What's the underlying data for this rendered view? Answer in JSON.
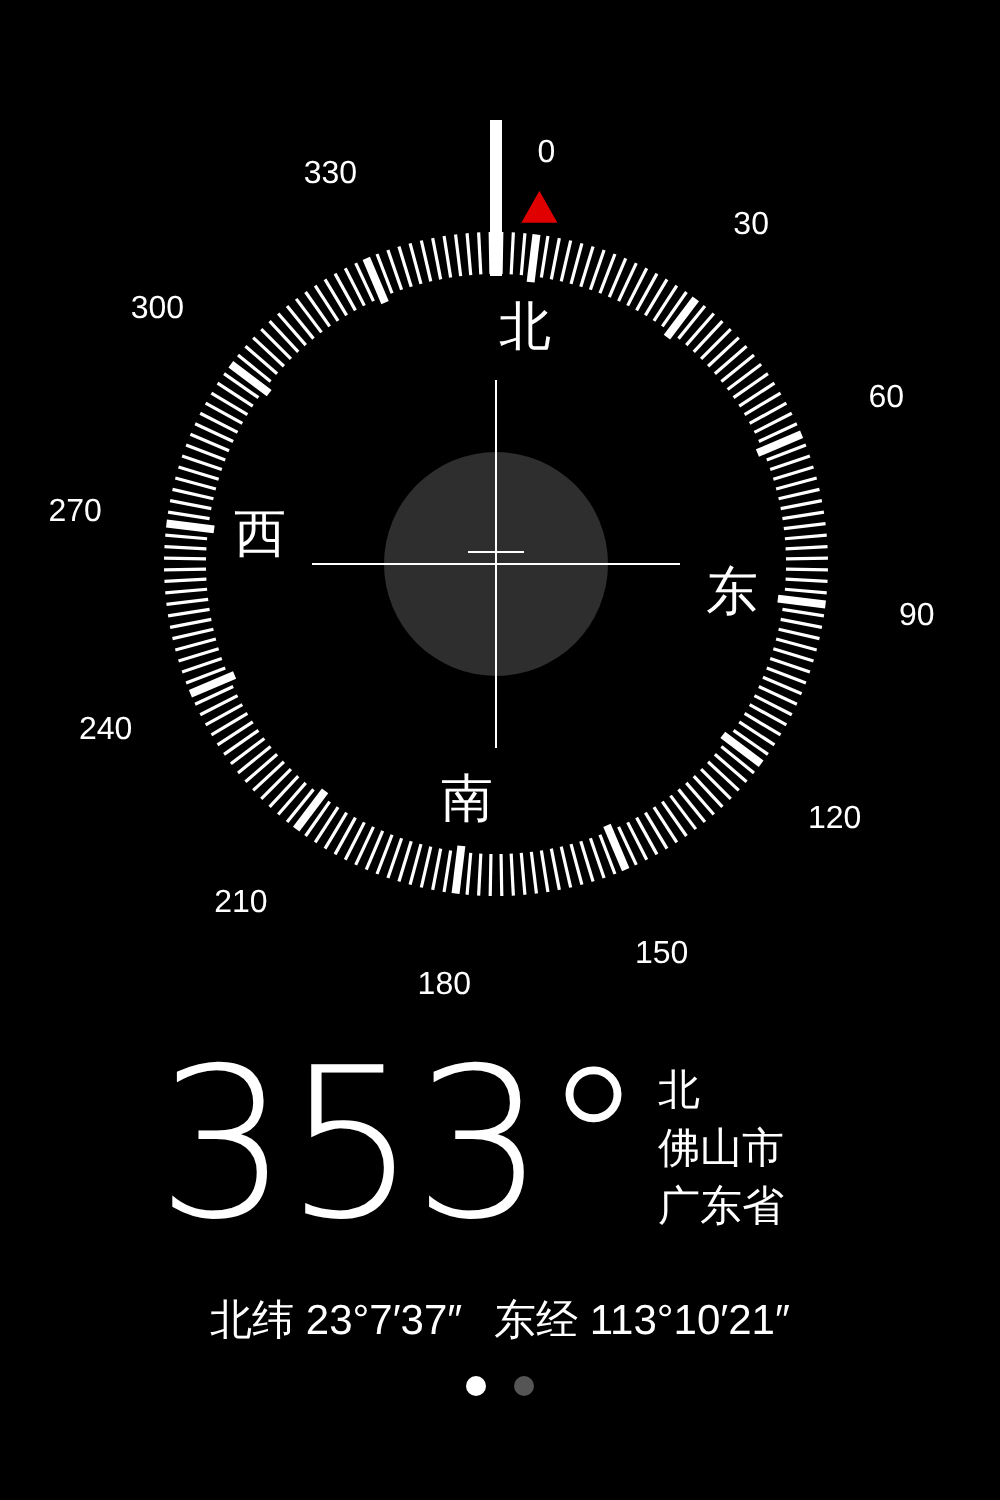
{
  "compass": {
    "degree_labels": [
      "0",
      "30",
      "60",
      "90",
      "120",
      "150",
      "180",
      "210",
      "240",
      "270",
      "300",
      "330"
    ],
    "cardinals": [
      "北",
      "东",
      "南",
      "西"
    ]
  },
  "reading": {
    "heading": "353°",
    "direction": "北",
    "city": "佛山市",
    "province": "广东省"
  },
  "coordinates": {
    "latitude": "北纬 23°7′37″",
    "longitude": "东经 113°10′21″"
  },
  "pages": [
    {
      "selected": true
    },
    {
      "selected": false
    }
  ]
}
